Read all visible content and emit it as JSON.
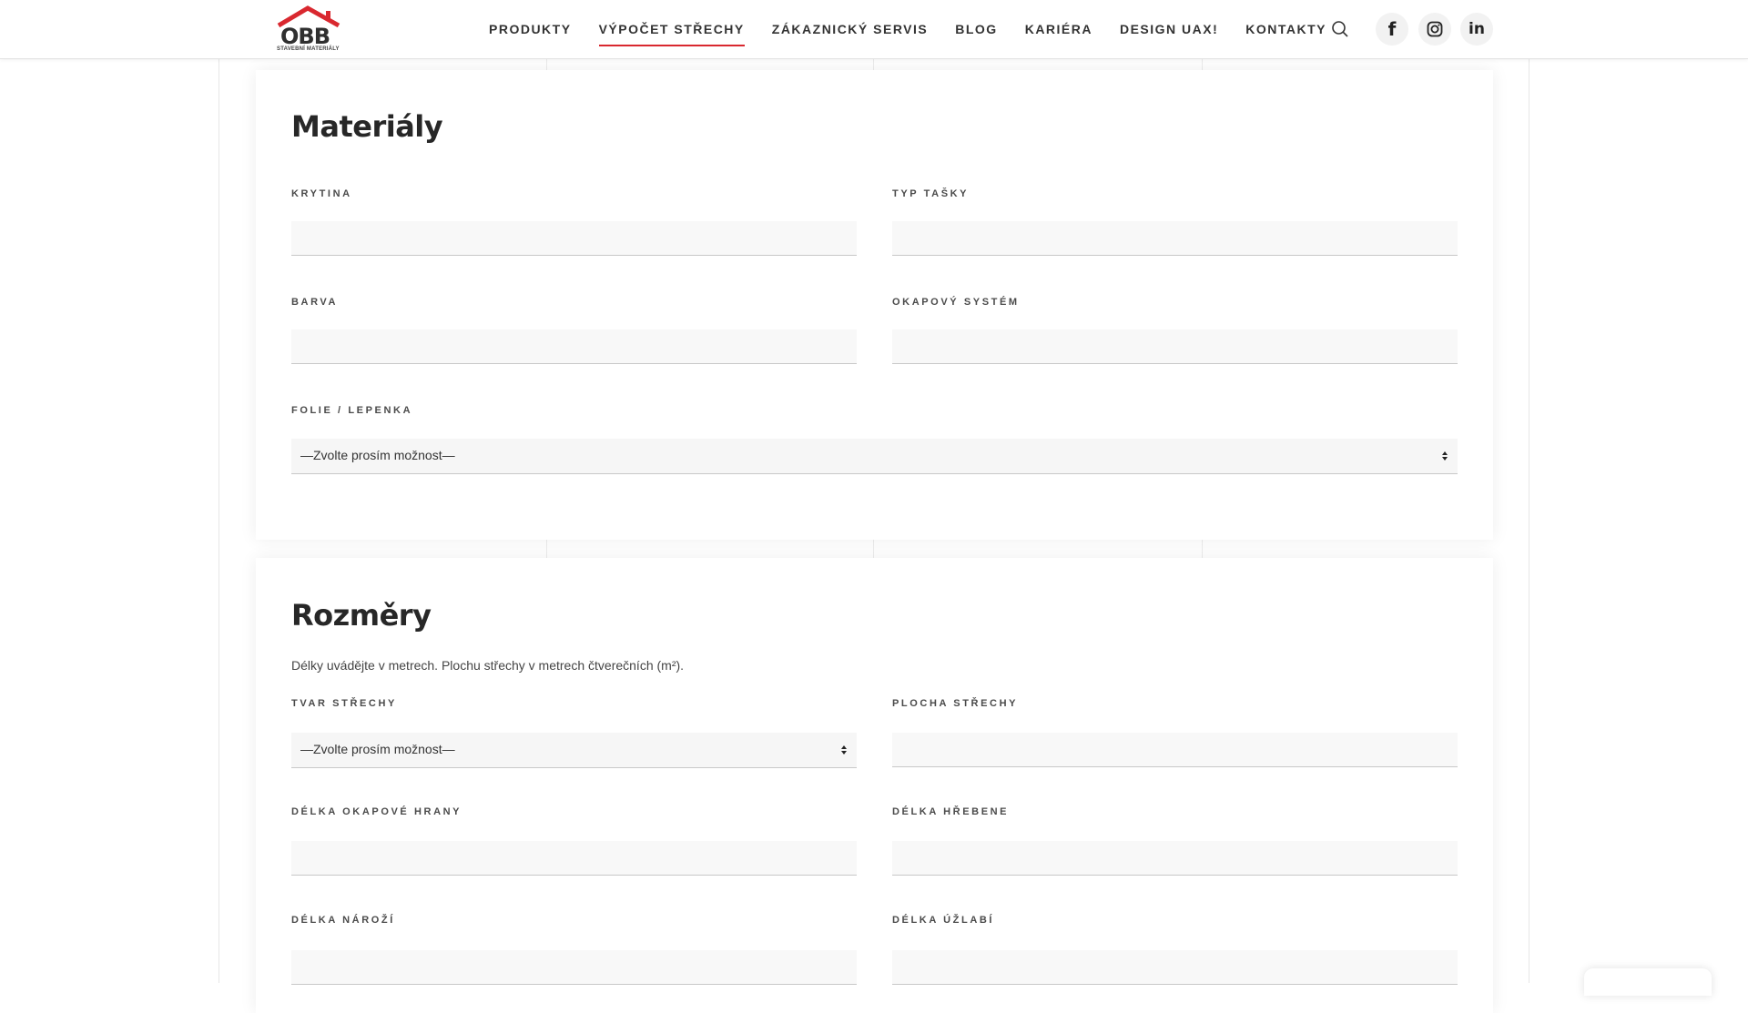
{
  "header": {
    "logo_text": "OBB",
    "logo_subtitle": "STAVEBNÍ MATERIÁLY",
    "nav": [
      {
        "label": "PRODUKTY"
      },
      {
        "label": "VÝPOČET STŘECHY",
        "active": true
      },
      {
        "label": "ZÁKAZNICKÝ SERVIS"
      },
      {
        "label": "BLOG"
      },
      {
        "label": "KARIÉRA"
      },
      {
        "label": "DESIGN UAX!"
      },
      {
        "label": "KONTAKTY"
      }
    ],
    "icons": [
      "search-icon",
      "facebook-icon",
      "instagram-icon",
      "linkedin-icon"
    ],
    "accent_color": "#d9282f"
  },
  "materials": {
    "title": "Materiály",
    "fields": {
      "krytina": {
        "label": "KRYTINA",
        "value": ""
      },
      "typ_tasky": {
        "label": "TYP TAŠKY",
        "value": ""
      },
      "barva": {
        "label": "BARVA",
        "value": ""
      },
      "okapovy_system": {
        "label": "OKAPOVÝ SYSTÉM",
        "value": ""
      },
      "folie": {
        "label": "FOLIE / LEPENKA",
        "selected": "—Zvolte prosím možnost—"
      }
    }
  },
  "dimensions": {
    "title": "Rozměry",
    "hint": "Délky uvádějte v metrech. Plochu střechy v metrech čtverečních (m²).",
    "fields": {
      "tvar_strechy": {
        "label": "TVAR STŘECHY",
        "selected": "—Zvolte prosím možnost—"
      },
      "plocha_strechy": {
        "label": "PLOCHA STŘECHY",
        "value": ""
      },
      "delka_okapove_hrany": {
        "label": "DÉLKA OKAPOVÉ HRANY",
        "value": ""
      },
      "delka_hrebene": {
        "label": "DÉLKA HŘEBENE",
        "value": ""
      },
      "delka_narozi": {
        "label": "DÉLKA NÁROŽÍ",
        "value": ""
      },
      "delka_uzlabi": {
        "label": "DÉLKA ÚŽLABÍ",
        "value": ""
      }
    }
  }
}
